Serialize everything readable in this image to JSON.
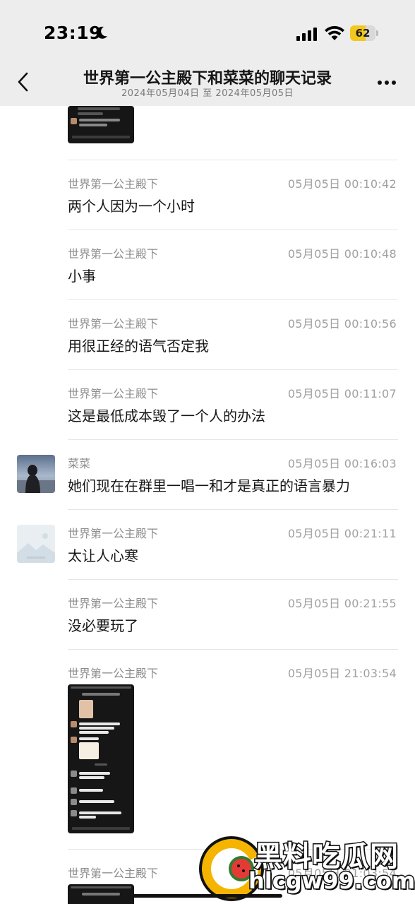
{
  "status_bar": {
    "time": "23:19",
    "focus_icon": "moon-icon",
    "signal_icon": "cellular-signal-icon",
    "wifi_icon": "wifi-icon",
    "battery_percent": "62",
    "battery_level": 0.62,
    "battery_color": "#f2c81e"
  },
  "nav": {
    "back_icon": "chevron-left-icon",
    "title": "世界第一公主殿下和菜菜的聊天记录",
    "subtitle": "2024年05月04日 至 2024年05月05日",
    "more_icon": "more-dots-icon",
    "background": "#ededed"
  },
  "messages": [
    {
      "sender": "世界第一公主殿下",
      "timestamp": "05月05日 00:10:42",
      "text": "两个人因为一个小时"
    },
    {
      "sender": "世界第一公主殿下",
      "timestamp": "05月05日 00:10:48",
      "text": "小事"
    },
    {
      "sender": "世界第一公主殿下",
      "timestamp": "05月05日 00:10:56",
      "text": "用很正经的语气否定我"
    },
    {
      "sender": "世界第一公主殿下",
      "timestamp": "05月05日 00:11:07",
      "text": "这是最低成本毁了一个人的办法"
    },
    {
      "sender": "菜菜",
      "timestamp": "05月05日 00:16:03",
      "text": "她们现在在群里一唱一和才是真正的语言暴力",
      "avatar": "photo-avatar"
    },
    {
      "sender": "世界第一公主殿下",
      "timestamp": "05月05日 00:21:11",
      "text": "太让人心寒",
      "avatar": "placeholder-avatar"
    },
    {
      "sender": "世界第一公主殿下",
      "timestamp": "05月05日 00:21:55",
      "text": "没必要玩了"
    },
    {
      "sender": "世界第一公主殿下",
      "timestamp": "05月05日 21:03:54",
      "image": "chat-screenshot-thumbnail"
    },
    {
      "sender": "世界第一公主殿下",
      "timestamp": "05月05日 21:03:54",
      "image": "chat-screenshot-thumbnail"
    }
  ],
  "watermark": {
    "line1": "黑料吃瓜网",
    "line2": "hlcgw99.com",
    "logo_icon": "watermelon-logo-icon",
    "accent": "#f5b400"
  }
}
